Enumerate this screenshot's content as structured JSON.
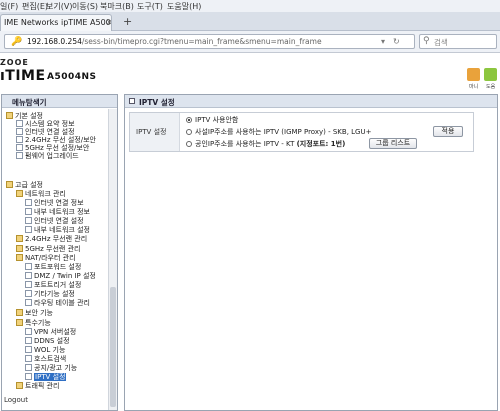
{
  "browser": {
    "menu": [
      "일(F)",
      "편집(E)",
      "보기(V)",
      "이동(S)",
      "북마크(B)",
      "도구(T)",
      "도움말(H)"
    ],
    "tab_title": "IME Networks ipTIME A5004...",
    "url_host": "192.168.0.254",
    "url_path": "/sess-bin/timepro.cgi?tmenu=main_frame&smenu=main_frame",
    "search_placeholder": "검색"
  },
  "router": {
    "logo_small": "ZOOE",
    "brand": "ıTIME",
    "model": "A5004NS",
    "header_buttons": [
      {
        "label": "마니",
        "color": "#e9a23b"
      },
      {
        "label": "도움",
        "color": "#8cc63f"
      }
    ]
  },
  "sidebar": {
    "title": "메뉴탐색기",
    "logout": "Logout",
    "items": [
      {
        "label": "기본 설정",
        "level": 0,
        "icon": "folder"
      },
      {
        "label": "시스템 요약 정보",
        "level": 1,
        "icon": "page"
      },
      {
        "label": "인터넷 연결 설정",
        "level": 1,
        "icon": "page"
      },
      {
        "label": "2.4GHz 무선 설정/보안",
        "level": 1,
        "icon": "page"
      },
      {
        "label": "5GHz 무선 설정/보안",
        "level": 1,
        "icon": "page"
      },
      {
        "label": "펌웨어 업그레이드",
        "level": 1,
        "icon": "page"
      },
      {
        "label": "고급 설정",
        "level": 0,
        "icon": "folder"
      },
      {
        "label": "네트워크 관리",
        "level": 1,
        "icon": "folder"
      },
      {
        "label": "인터넷 연결 정보",
        "level": 2,
        "icon": "page"
      },
      {
        "label": "내부 네트워크 정보",
        "level": 2,
        "icon": "page"
      },
      {
        "label": "인터넷 연결 설정",
        "level": 2,
        "icon": "page"
      },
      {
        "label": "내부 네트워크 설정",
        "level": 2,
        "icon": "page"
      },
      {
        "label": "2.4GHz 무선랜 관리",
        "level": 1,
        "icon": "folder"
      },
      {
        "label": "5GHz 무선랜 관리",
        "level": 1,
        "icon": "folder"
      },
      {
        "label": "NAT/라우터 관리",
        "level": 1,
        "icon": "folder"
      },
      {
        "label": "포트포워드 설정",
        "level": 2,
        "icon": "page"
      },
      {
        "label": "DMZ / Twin IP 설정",
        "level": 2,
        "icon": "page"
      },
      {
        "label": "포트트리거 설정",
        "level": 2,
        "icon": "page"
      },
      {
        "label": "기타기능 설정",
        "level": 2,
        "icon": "page"
      },
      {
        "label": "라우팅 테이블 관리",
        "level": 2,
        "icon": "page"
      },
      {
        "label": "보안 기능",
        "level": 1,
        "icon": "folder"
      },
      {
        "label": "특수기능",
        "level": 1,
        "icon": "folder"
      },
      {
        "label": "VPN 서버설정",
        "level": 2,
        "icon": "page"
      },
      {
        "label": "DDNS 설정",
        "level": 2,
        "icon": "page"
      },
      {
        "label": "WOL 기능",
        "level": 2,
        "icon": "page"
      },
      {
        "label": "호스트검색",
        "level": 2,
        "icon": "page"
      },
      {
        "label": "공지/광고 기능",
        "level": 2,
        "icon": "page"
      },
      {
        "label": "IPTV 설정",
        "level": 2,
        "icon": "page",
        "selected": true
      },
      {
        "label": "트래픽 관리",
        "level": 1,
        "icon": "folder"
      }
    ]
  },
  "main": {
    "title": "IPTV 설정",
    "field_label": "IPTV 설정",
    "options": [
      {
        "label": "IPTV 사용안함",
        "checked": true
      },
      {
        "label": "사설IP주소를 사용하는 IPTV (IGMP Proxy) - SKB, LGU+",
        "checked": false
      },
      {
        "label": "공인IP주소를 사용하는 IPTV - KT ",
        "bold_suffix": "(지정포트: 1번)",
        "checked": false
      }
    ],
    "apply_button": "적용",
    "group_list_button": "그룹 리스트"
  }
}
